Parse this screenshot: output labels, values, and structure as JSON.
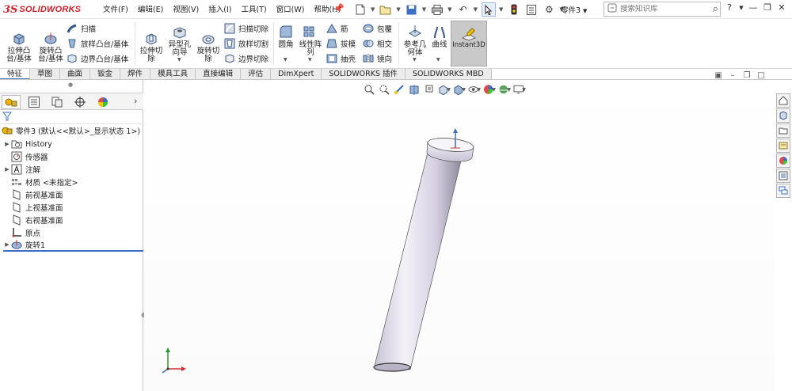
{
  "app": {
    "logo_mark": "3S",
    "logo_text": "SOLIDWORKS",
    "document_title": "零件3",
    "search_placeholder": "搜索知识库"
  },
  "menu": [
    "文件(F)",
    "编辑(E)",
    "视图(V)",
    "插入(I)",
    "工具(T)",
    "窗口(W)",
    "帮助(H)"
  ],
  "window_controls": {
    "help": "?",
    "minimize": "—",
    "restore": "❐",
    "close": "✕"
  },
  "ribbon": {
    "extrude_boss": "拉伸凸\n台/基体",
    "revolve_boss": "旋转凸\n台/基体",
    "sweep": "扫描",
    "loft_boss": "放样凸台/基体",
    "boundary_boss": "边界凸台/基体",
    "extrude_cut": "拉伸切\n除",
    "hole_wizard": "异型孔\n向导",
    "revolve_cut": "旋转切\n除",
    "swept_cut": "扫描切除",
    "lofted_cut": "放样切割",
    "boundary_cut": "边界切除",
    "fillet": "圆角",
    "linear_pattern": "线性阵\n列",
    "rib": "筋",
    "draft": "拔模",
    "shell": "抽壳",
    "wrap": "包覆",
    "intersect": "相交",
    "mirror": "镜向",
    "reference_geometry": "参考几\n何体",
    "curves": "曲线",
    "instant3d": "Instant3D"
  },
  "tabs": [
    "特征",
    "草图",
    "曲面",
    "钣金",
    "焊件",
    "模具工具",
    "直接编辑",
    "评估",
    "DimXpert",
    "SOLIDWORKS 插件",
    "SOLIDWORKS MBD"
  ],
  "tree": {
    "root": "零件3  (默认<<默认>_显示状态 1>)",
    "items": [
      {
        "label": "History",
        "icon": "history-icon",
        "expandable": true
      },
      {
        "label": "传感器",
        "icon": "sensor-icon",
        "expandable": false
      },
      {
        "label": "注解",
        "icon": "annotation-icon",
        "expandable": true
      },
      {
        "label": "材质 <未指定>",
        "icon": "material-icon",
        "expandable": false
      },
      {
        "label": "前视基准面",
        "icon": "plane-icon",
        "expandable": false
      },
      {
        "label": "上视基准面",
        "icon": "plane-icon",
        "expandable": false
      },
      {
        "label": "右视基准面",
        "icon": "plane-icon",
        "expandable": false
      },
      {
        "label": "原点",
        "icon": "origin-icon",
        "expandable": false
      },
      {
        "label": "旋转1",
        "icon": "revolve-feature-icon",
        "expandable": true
      }
    ]
  },
  "colors": {
    "accent": "#3a6fc4",
    "brand": "#d2202a",
    "model": "#d9d4e4"
  }
}
